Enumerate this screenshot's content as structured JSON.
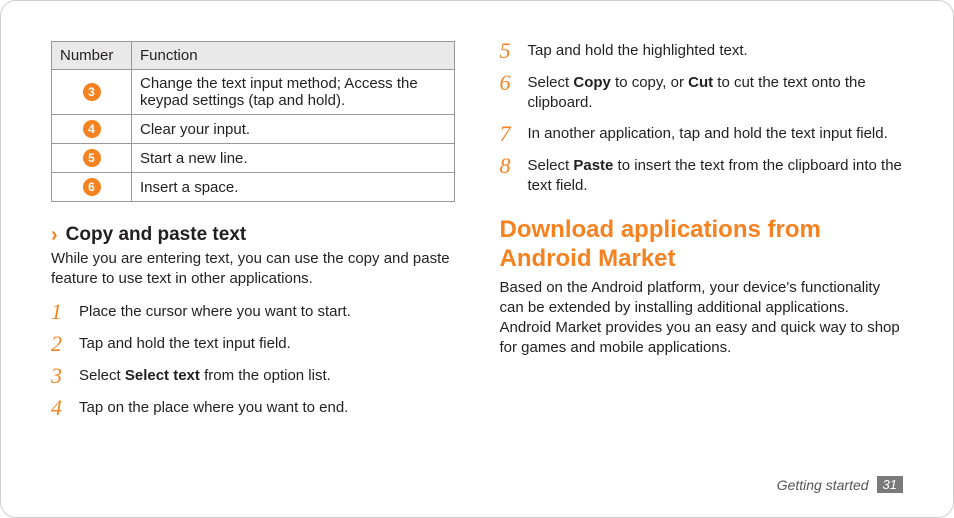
{
  "table": {
    "head": {
      "c1": "Number",
      "c2": "Function"
    },
    "rows": [
      {
        "n": "3",
        "fn": "Change the text input method; Access the keypad settings (tap and hold)."
      },
      {
        "n": "4",
        "fn": "Clear your input."
      },
      {
        "n": "5",
        "fn": "Start a new line."
      },
      {
        "n": "6",
        "fn": "Insert a space."
      }
    ]
  },
  "subhead": "Copy and paste text",
  "subpara": "While you are entering text, you can use the copy and paste feature to use text in other applications.",
  "steps_left": [
    {
      "n": "1",
      "pre": "Place the cursor where you want to start.",
      "b": "",
      "post": ""
    },
    {
      "n": "2",
      "pre": "Tap and hold the text input field.",
      "b": "",
      "post": ""
    },
    {
      "n": "3",
      "pre": "Select ",
      "b": "Select text",
      "post": " from the option list."
    },
    {
      "n": "4",
      "pre": "Tap on the place where you want to end.",
      "b": "",
      "post": ""
    }
  ],
  "steps_right": [
    {
      "n": "5",
      "pre": "Tap and hold the highlighted text.",
      "b": "",
      "b2": "",
      "mid": "",
      "post": ""
    },
    {
      "n": "6",
      "pre": "Select ",
      "b": "Copy",
      "mid": " to copy, or ",
      "b2": "Cut",
      "post": " to cut the text onto the clipboard."
    },
    {
      "n": "7",
      "pre": "In another application, tap and hold the text input field.",
      "b": "",
      "b2": "",
      "mid": "",
      "post": ""
    },
    {
      "n": "8",
      "pre": "Select ",
      "b": "Paste",
      "mid": "",
      "b2": "",
      "post": " to insert the text from the clipboard into the text field."
    }
  ],
  "section_title": "Download applications from Android Market",
  "section_para": "Based on the Android platform, your device's functionality can be extended by installing additional applications. Android Market provides you an easy and quick way to shop for games and mobile applications.",
  "footer": {
    "chapter": "Getting started",
    "page": "31"
  }
}
